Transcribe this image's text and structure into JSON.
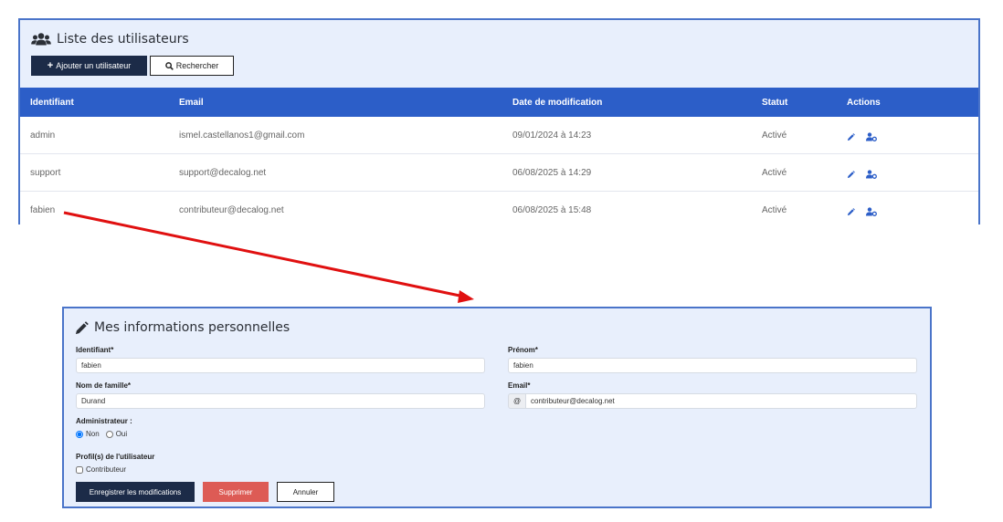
{
  "users_list": {
    "title": "Liste des utilisateurs",
    "add_button": "Ajouter un utilisateur",
    "search_button": "Rechercher",
    "columns": [
      "Identifiant",
      "Email",
      "Date de modification",
      "Statut",
      "Actions"
    ],
    "rows": [
      {
        "id": "admin",
        "email": "ismel.castellanos1@gmail.com",
        "date": "09/01/2024 à 14:23",
        "status": "Activé"
      },
      {
        "id": "support",
        "email": "support@decalog.net",
        "date": "06/08/2025 à 14:29",
        "status": "Activé"
      },
      {
        "id": "fabien",
        "email": "contributeur@decalog.net",
        "date": "06/08/2025 à 15:48",
        "status": "Activé"
      }
    ],
    "row_actions": [
      "pencil-icon",
      "user-cog-icon"
    ]
  },
  "form": {
    "title": "Mes informations personnelles",
    "identifiant_label": "Identifiant*",
    "identifiant_value": "fabien",
    "prenom_label": "Prénom*",
    "prenom_value": "fabien",
    "nom_label": "Nom de famille*",
    "nom_value": "Durand",
    "email_label": "Email*",
    "email_prefix": "@",
    "email_value": "contributeur@decalog.net",
    "admin_label": "Administrateur :",
    "admin_options": [
      "Non",
      "Oui"
    ],
    "admin_selected": "Non",
    "profiles_label": "Profil(s) de l'utilisateur",
    "profile_options": [
      "Contributeur"
    ],
    "save_button": "Enregistrer les modifications",
    "delete_button": "Supprimer",
    "cancel_button": "Annuler"
  },
  "colors": {
    "panel_bg": "#e8effc",
    "panel_border": "#4a74c9",
    "table_header": "#2c5ec8",
    "primary_button": "#1c2b48",
    "danger_button": "#dd5b55",
    "action_icon": "#2c5ec8",
    "arrow": "#e01010"
  }
}
